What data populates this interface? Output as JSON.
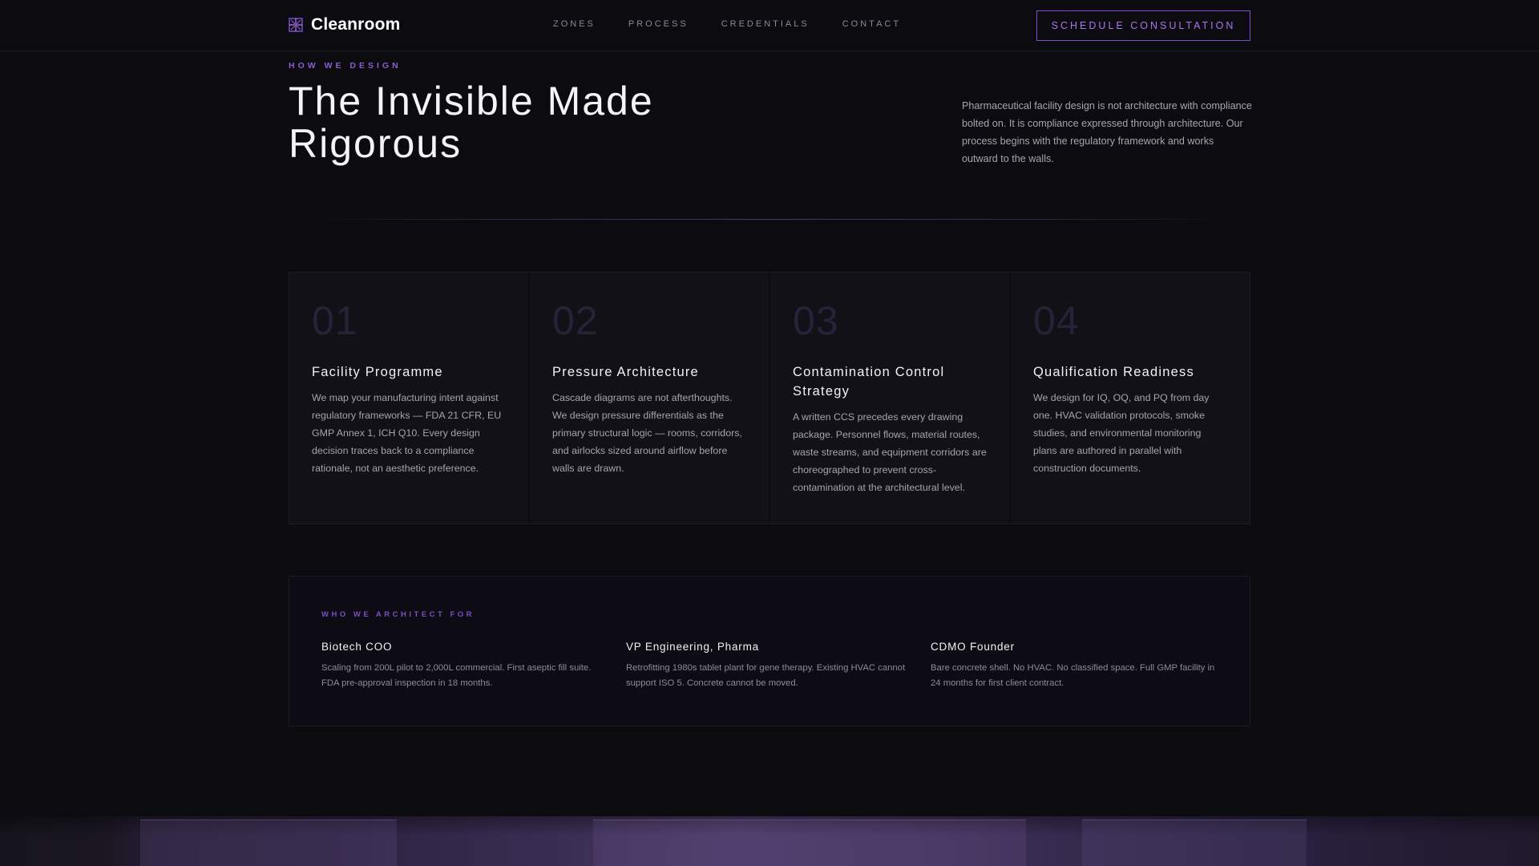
{
  "header": {
    "brand_name": "Cleanroom",
    "nav": [
      {
        "label": "ZONES"
      },
      {
        "label": "PROCESS"
      },
      {
        "label": "CREDENTIALS"
      },
      {
        "label": "CONTACT"
      }
    ],
    "cta_label": "SCHEDULE CONSULTATION"
  },
  "intro": {
    "eyebrow": "HOW WE DESIGN",
    "headline": "The Invisible Made Rigorous",
    "description": "Pharmaceutical facility design is not architecture with compliance bolted on. It is compliance expressed through architecture. Our process begins with the regulatory framework and works outward to the walls."
  },
  "steps": [
    {
      "number": "01",
      "title": "Facility Programme",
      "body": "We map your manufacturing intent against regulatory frameworks — FDA 21 CFR, EU GMP Annex 1, ICH Q10. Every design decision traces back to a compliance rationale, not an aesthetic preference."
    },
    {
      "number": "02",
      "title": "Pressure Architecture",
      "body": "Cascade diagrams are not afterthoughts. We design pressure differentials as the primary structural logic — rooms, corridors, and airlocks sized around airflow before walls are drawn."
    },
    {
      "number": "03",
      "title": "Contamination Control Strategy",
      "body": "A written CCS precedes every drawing package. Personnel flows, material routes, waste streams, and equipment corridors are choreographed to prevent cross-contamination at the architectural level."
    },
    {
      "number": "04",
      "title": "Qualification Readiness",
      "body": "We design for IQ, OQ, and PQ from day one. HVAC validation protocols, smoke studies, and environmental monitoring plans are authored in parallel with construction documents."
    }
  ],
  "audience": {
    "eyebrow": "WHO WE ARCHITECT FOR",
    "personas": [
      {
        "title": "Biotech COO",
        "body": "Scaling from 200L pilot to 2,000L commercial. First aseptic fill suite. FDA pre-approval inspection in 18 months."
      },
      {
        "title": "VP Engineering, Pharma",
        "body": "Retrofitting 1980s tablet plant for gene therapy. Existing HVAC cannot support ISO 5. Concrete cannot be moved."
      },
      {
        "title": "CDMO Founder",
        "body": "Bare concrete shell. No HVAC. No classified space. Full GMP facility in 24 months for first client contract."
      }
    ]
  },
  "colors": {
    "background": "#0b0b10",
    "accent": "#a777f0",
    "card": "#111117"
  },
  "icons": {
    "brand": "cleanroom-logo-icon"
  }
}
